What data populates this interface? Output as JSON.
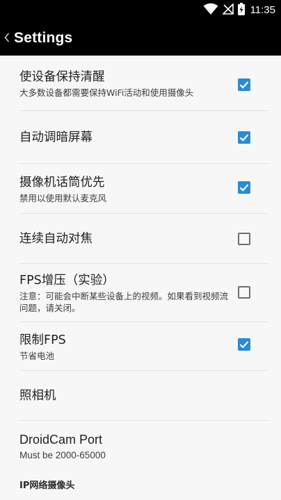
{
  "status_bar": {
    "time": "11:35",
    "icons": [
      "wifi-icon",
      "no-signal-icon",
      "battery-icon"
    ]
  },
  "app_bar": {
    "back_icon": "chevron-left-icon",
    "title": "Settings"
  },
  "colors": {
    "bar_bg": "#000000",
    "content_bg": "#f7f7f7",
    "checkbox_accent": "#2a8ad4"
  },
  "preferences": [
    {
      "title": "使设备保持清醒",
      "summary": "大多数设备都需要保持WiFi活动和使用摄像头",
      "checked": true
    },
    {
      "title": "自动调暗屏幕",
      "summary": "",
      "checked": true
    },
    {
      "title": "摄像机话筒优先",
      "summary": "禁用以使用默认麦克风",
      "checked": true
    },
    {
      "title": "连续自动对焦",
      "summary": "",
      "checked": false
    },
    {
      "title": "FPS增压（实验）",
      "summary": "注意：可能会中断某些设备上的视频。如果看到视频流问题，请关闭。",
      "checked": false
    },
    {
      "title": "限制FPS",
      "summary": "节省电池",
      "checked": true
    },
    {
      "title": "照相机",
      "summary": ""
    },
    {
      "title": "DroidCam Port",
      "summary": "Must be 2000-65000"
    }
  ],
  "category_header": "IP网络摄像头"
}
